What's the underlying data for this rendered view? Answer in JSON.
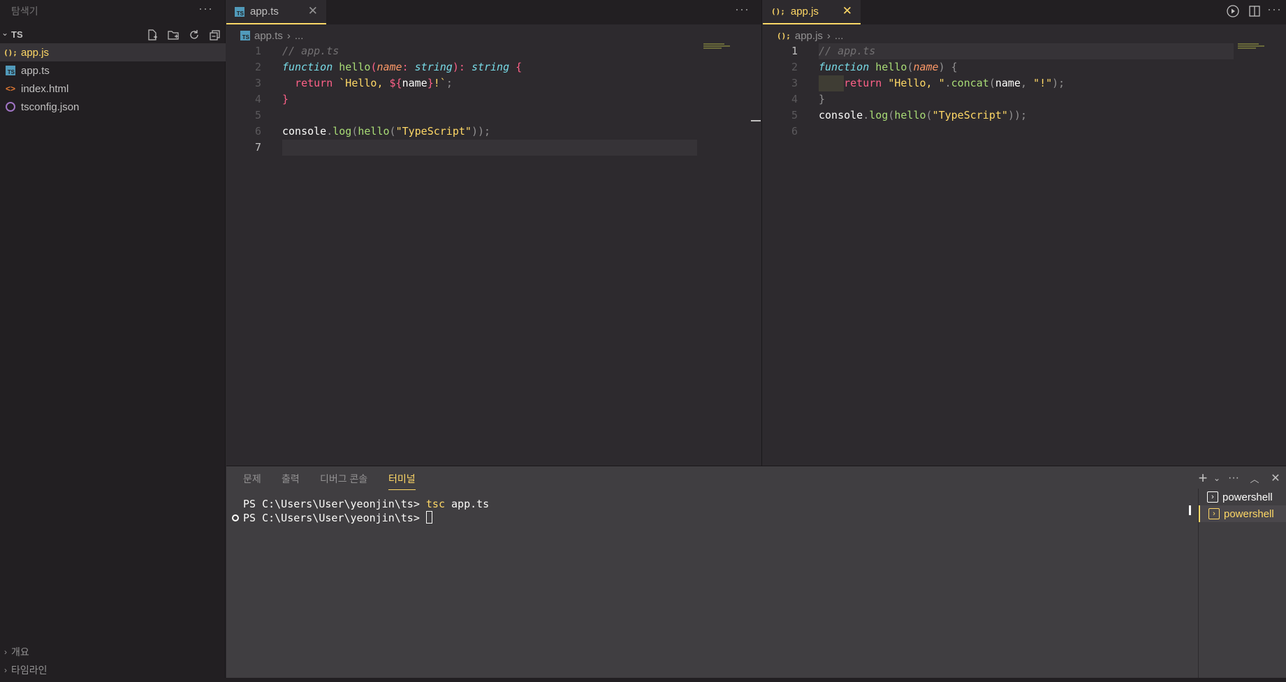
{
  "colors": {
    "accent": "#ffd866",
    "background": "#2d2a2e",
    "sidebar": "#221f22",
    "panel": "#403e41"
  },
  "sidebar": {
    "title": "탐색기",
    "more": "···",
    "folder": "TS",
    "files": [
      {
        "name": "app.js",
        "icon": "js-icon",
        "glyph": "();",
        "selected": true
      },
      {
        "name": "app.ts",
        "icon": "ts-icon",
        "glyph": "TS",
        "selected": false
      },
      {
        "name": "index.html",
        "icon": "html-icon",
        "glyph": "<>",
        "selected": false
      },
      {
        "name": "tsconfig.json",
        "icon": "json-icon",
        "glyph": "",
        "selected": false
      }
    ],
    "sections": [
      "개요",
      "타임라인"
    ]
  },
  "left_editor": {
    "tab": {
      "label": "app.ts",
      "glyph": "TS",
      "close": "✕"
    },
    "more": "···",
    "breadcrumb": {
      "file": "app.ts",
      "sep": "›",
      "rest": "..."
    },
    "line_numbers": [
      "1",
      "2",
      "3",
      "4",
      "5",
      "6",
      "7"
    ],
    "current_line": "7"
  },
  "right_editor": {
    "tab": {
      "label": "app.js",
      "glyph": "();",
      "close": "✕"
    },
    "more": "···",
    "breadcrumb": {
      "file": "app.js",
      "sep": "›",
      "rest": "..."
    },
    "line_numbers": [
      "1",
      "2",
      "3",
      "4",
      "5",
      "6"
    ],
    "current_line": "1"
  },
  "panel": {
    "tabs": [
      "문제",
      "출력",
      "디버그 콘솔",
      "터미널"
    ],
    "active_tab": "터미널",
    "terminal": {
      "prompt": "PS C:\\Users\\User\\yeonjin\\ts> ",
      "command_name": "tsc",
      "command_args": " app.ts"
    },
    "terminals": [
      "powershell",
      "powershell"
    ]
  }
}
